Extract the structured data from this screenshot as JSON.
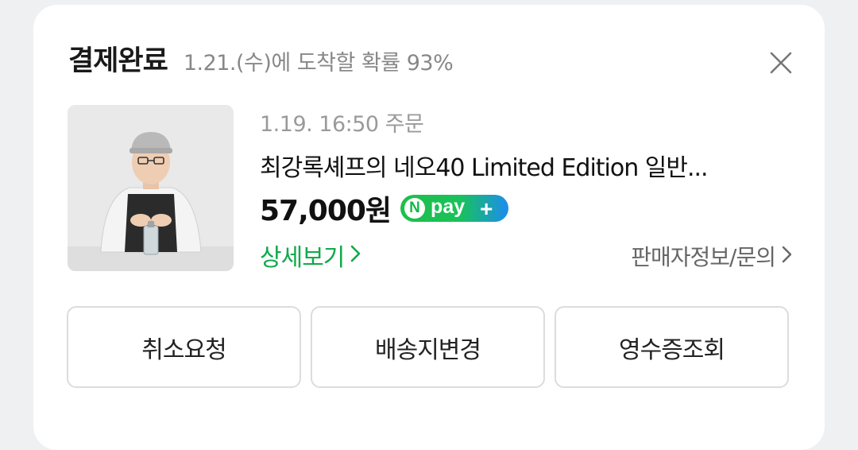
{
  "header": {
    "title": "결제완료",
    "arrival": "1.21.(수)에 도착할 확률 93%"
  },
  "icons": {
    "close": "close-icon",
    "detail_chevron": "chevron-right-icon",
    "seller_chevron": "chevron-right-icon"
  },
  "order": {
    "date": "1.19. 16:50 주문",
    "product_name": "최강록셰프의 네오40 Limited Edition 일반...",
    "price": "57,000원",
    "npay": {
      "n": "N",
      "pay": "pay",
      "plus": "+"
    },
    "detail_link": "상세보기",
    "seller_link": "판매자정보/문의"
  },
  "actions": {
    "cancel": "취소요청",
    "change_address": "배송지변경",
    "receipt": "영수증조회"
  },
  "colors": {
    "accent_green": "#10a94a",
    "npay_green": "#1fbf4a",
    "npay_blue": "#1d8cf0"
  }
}
